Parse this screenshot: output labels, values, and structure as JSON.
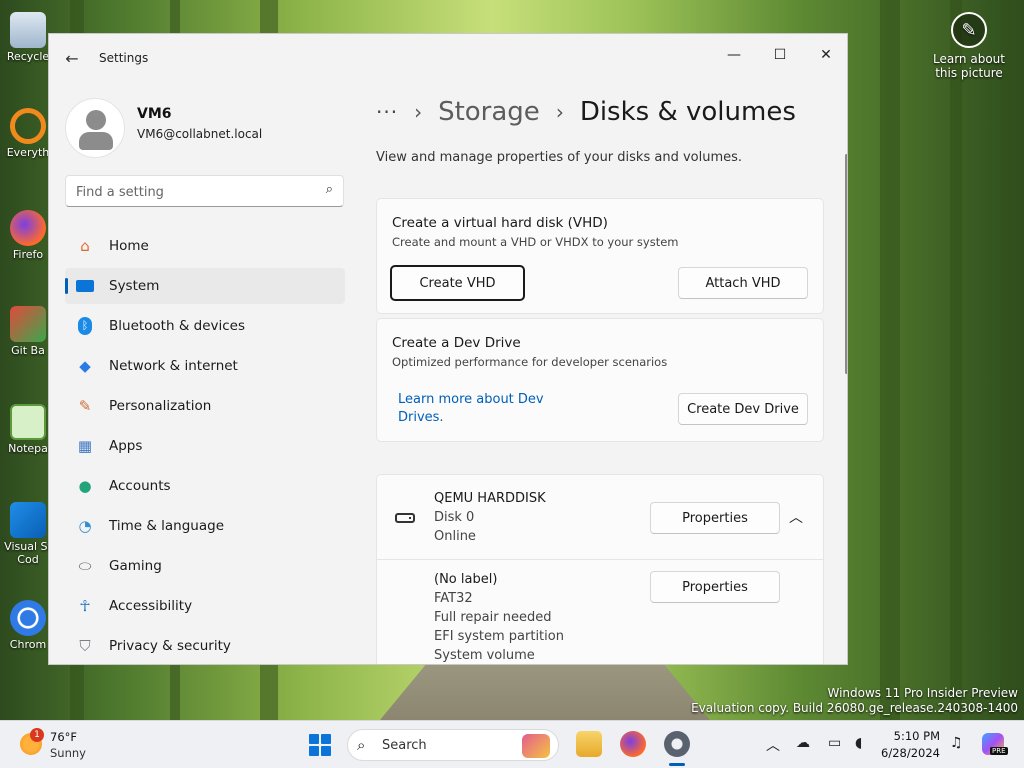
{
  "desktop": {
    "icons": [
      {
        "label": "Recycle",
        "icon": "recycle-bin-icon"
      },
      {
        "label": "Everyth",
        "icon": "everything-search-icon"
      },
      {
        "label": "Firefo",
        "icon": "firefox-icon"
      },
      {
        "label": "Git Ba",
        "icon": "git-bash-icon"
      },
      {
        "label": "Notepa",
        "icon": "notepad-icon"
      },
      {
        "label": "Visual St\nCod",
        "icon": "vscode-icon"
      },
      {
        "label": "Chrom",
        "icon": "chrome-icon"
      }
    ],
    "learn_label": "Learn about this picture",
    "watermark_line1": "Windows 11 Pro Insider Preview",
    "watermark_line2": "Evaluation copy. Build 26080.ge_release.240308-1400"
  },
  "window": {
    "title": "Settings",
    "controls": {
      "minimize": "—",
      "maximize": "☐",
      "close": "✕"
    }
  },
  "profile": {
    "name": "VM6",
    "email": "VM6@collabnet.local"
  },
  "search": {
    "placeholder": "Find a setting"
  },
  "nav": {
    "items": [
      {
        "label": "Home",
        "icon": "home-icon",
        "color": "#e0672c"
      },
      {
        "label": "System",
        "icon": "system-icon",
        "color": "#0a74d8"
      },
      {
        "label": "Bluetooth & devices",
        "icon": "bluetooth-icon",
        "color": "#1a8ae8"
      },
      {
        "label": "Network & internet",
        "icon": "wifi-icon",
        "color": "#2c7be5"
      },
      {
        "label": "Personalization",
        "icon": "brush-icon",
        "color": "#c9703a"
      },
      {
        "label": "Apps",
        "icon": "apps-icon",
        "color": "#3e78c4"
      },
      {
        "label": "Accounts",
        "icon": "accounts-icon",
        "color": "#23a37a"
      },
      {
        "label": "Time & language",
        "icon": "globe-clock-icon",
        "color": "#2f8fd1"
      },
      {
        "label": "Gaming",
        "icon": "gamepad-icon",
        "color": "#6b6b6b"
      },
      {
        "label": "Accessibility",
        "icon": "accessibility-icon",
        "color": "#1b73c8"
      },
      {
        "label": "Privacy & security",
        "icon": "shield-icon",
        "color": "#7b7f85"
      }
    ],
    "active_index": 1
  },
  "breadcrumb": {
    "more": "···",
    "sep": "›",
    "parent": "Storage",
    "current": "Disks & volumes"
  },
  "page": {
    "description": "View and manage properties of your disks and volumes."
  },
  "vhd_card": {
    "title": "Create a virtual hard disk (VHD)",
    "subtitle": "Create and mount a VHD or VHDX to your system",
    "create_button": "Create VHD",
    "attach_button": "Attach VHD"
  },
  "devdrive_card": {
    "title": "Create a Dev Drive",
    "subtitle": "Optimized performance for developer scenarios",
    "link_text": "Learn more about Dev Drives.",
    "button": "Create Dev Drive"
  },
  "disk": {
    "name": "QEMU HARDDISK",
    "number": "Disk 0",
    "status": "Online",
    "properties_button": "Properties",
    "volume": {
      "label": "(No label)",
      "filesystem": "FAT32",
      "health": "Full repair needed",
      "type": "EFI system partition",
      "role": "System volume",
      "properties_button": "Properties"
    }
  },
  "taskbar": {
    "weather_temp": "76°F",
    "weather_cond": "Sunny",
    "weather_badge": "1",
    "search_label": "Search",
    "time": "5:10 PM",
    "date": "6/28/2024",
    "copilot_badge": "PRE"
  }
}
